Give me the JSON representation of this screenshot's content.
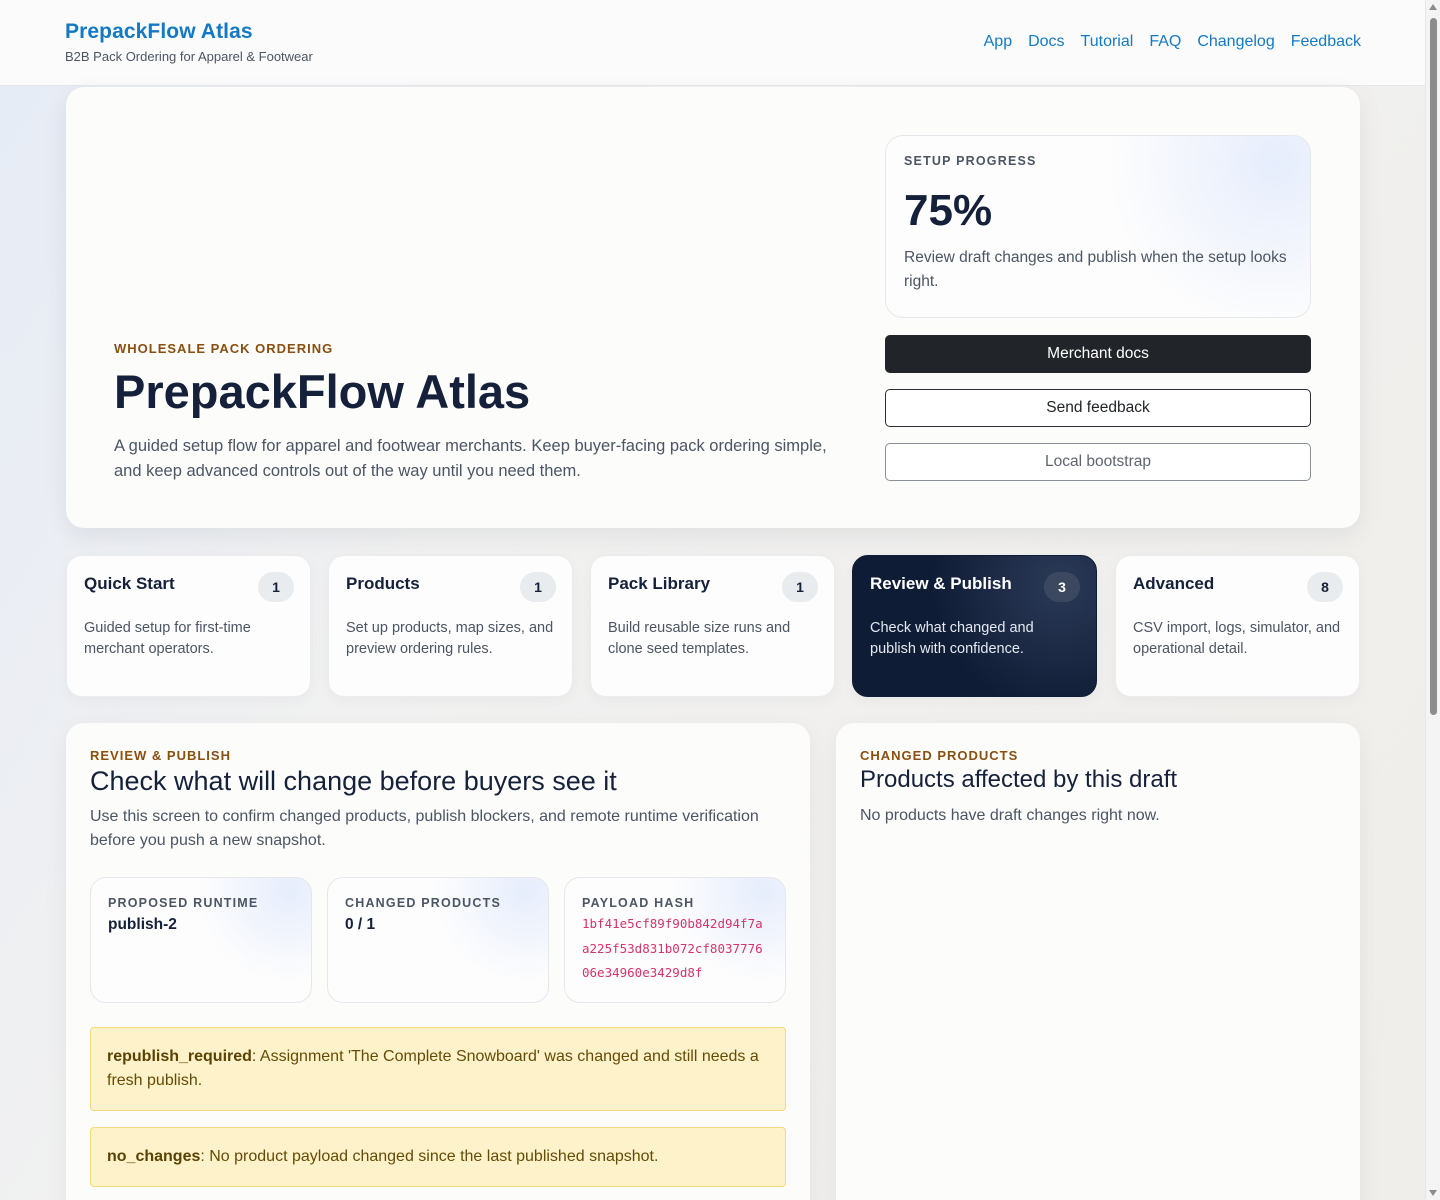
{
  "header": {
    "brand_title": "PrepackFlow Atlas",
    "brand_subtitle": "B2B Pack Ordering for Apparel & Footwear",
    "nav": [
      "App",
      "Docs",
      "Tutorial",
      "FAQ",
      "Changelog",
      "Feedback"
    ]
  },
  "hero": {
    "eyebrow": "WHOLESALE PACK ORDERING",
    "title": "PrepackFlow Atlas",
    "description": "A guided setup flow for apparel and footwear merchants. Keep buyer-facing pack ordering simple, and keep advanced controls out of the way until you need them.",
    "progress_label": "SETUP PROGRESS",
    "progress_value": "75%",
    "progress_fraction": 0.75,
    "progress_description": "Review draft changes and publish when the setup looks right.",
    "buttons": {
      "merchant_docs": "Merchant docs",
      "send_feedback": "Send feedback",
      "local_bootstrap": "Local bootstrap"
    }
  },
  "tabs": [
    {
      "title": "Quick Start",
      "count": "1",
      "description": "Guided setup for first-time merchant operators.",
      "active": false
    },
    {
      "title": "Products",
      "count": "1",
      "description": "Set up products, map sizes, and preview ordering rules.",
      "active": false
    },
    {
      "title": "Pack Library",
      "count": "1",
      "description": "Build reusable size runs and clone seed templates.",
      "active": false
    },
    {
      "title": "Review & Publish",
      "count": "3",
      "description": "Check what changed and publish with confidence.",
      "active": true
    },
    {
      "title": "Advanced",
      "count": "8",
      "description": "CSV import, logs, simulator, and operational detail.",
      "active": false
    }
  ],
  "review": {
    "eyebrow": "REVIEW & PUBLISH",
    "title": "Check what will change before buyers see it",
    "description": "Use this screen to confirm changed products, publish blockers, and remote runtime verification before you push a new snapshot.",
    "stats": {
      "runtime_label": "PROPOSED RUNTIME",
      "runtime_value": "publish-2",
      "changed_label": "CHANGED PRODUCTS",
      "changed_value": "0 / 1",
      "hash_label": "PAYLOAD HASH",
      "hash_value": "1bf41e5cf89f90b842d94f7aa225f53d831b072cf803777606e34960e3429d8f"
    },
    "alerts": [
      {
        "code": "republish_required",
        "message": ": Assignment 'The Complete Snowboard' was changed and still needs a fresh publish."
      },
      {
        "code": "no_changes",
        "message": ": No product payload changed since the last published snapshot."
      }
    ]
  },
  "changed_products": {
    "eyebrow": "CHANGED PRODUCTS",
    "title": "Products affected by this draft",
    "empty_message": "No products have draft changes right now."
  },
  "colors": {
    "brand": "#1479c4",
    "eyebrow": "#8a4e0f",
    "active_tab": "#0f1c35",
    "alert_bg": "#fdf2c9",
    "hash": "#d6336c"
  }
}
